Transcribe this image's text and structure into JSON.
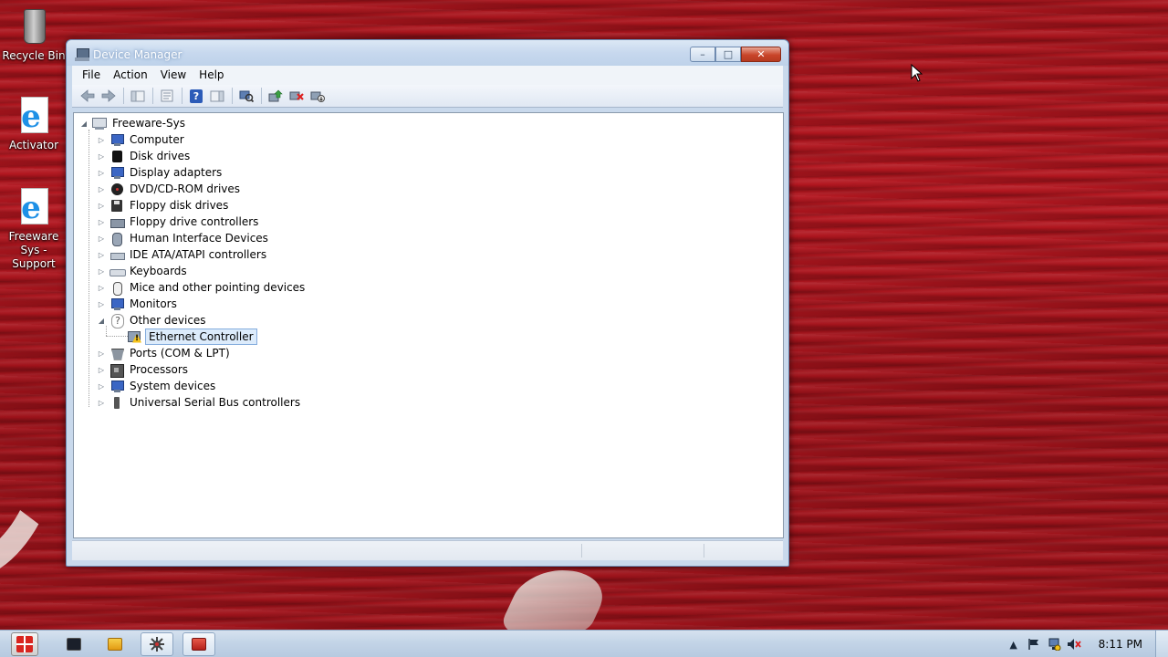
{
  "desktop": {
    "icons": [
      {
        "label": "Recycle Bin",
        "icon": "recycle-bin-icon"
      },
      {
        "label": "Activator",
        "icon": "internet-explorer-icon"
      },
      {
        "label": "Freeware Sys - Support",
        "icon": "internet-explorer-icon"
      }
    ]
  },
  "window": {
    "title": "Device Manager",
    "controls": {
      "minimize": "–",
      "maximize": "□",
      "close": "✕"
    },
    "menu": [
      "File",
      "Action",
      "View",
      "Help"
    ],
    "toolbar": {
      "back": "back-arrow-icon",
      "forward": "forward-arrow-icon",
      "help": "?"
    },
    "tree": {
      "root": "Freeware-Sys",
      "categories": [
        "Computer",
        "Disk drives",
        "Display adapters",
        "DVD/CD-ROM drives",
        "Floppy disk drives",
        "Floppy drive controllers",
        "Human Interface Devices",
        "IDE ATA/ATAPI controllers",
        "Keyboards",
        "Mice and other pointing devices",
        "Monitors",
        "Other devices",
        "Ethernet Controller",
        "Ports (COM & LPT)",
        "Processors",
        "System devices",
        "Universal Serial Bus controllers"
      ],
      "selected": "Ethernet Controller"
    }
  },
  "taskbar": {
    "clock": "8:11 PM"
  },
  "colors": {
    "wallpaper": "#a8141c",
    "window_frame": "#c9d9ec",
    "selection": "#dcebfb",
    "warning": "#f4c21a"
  }
}
